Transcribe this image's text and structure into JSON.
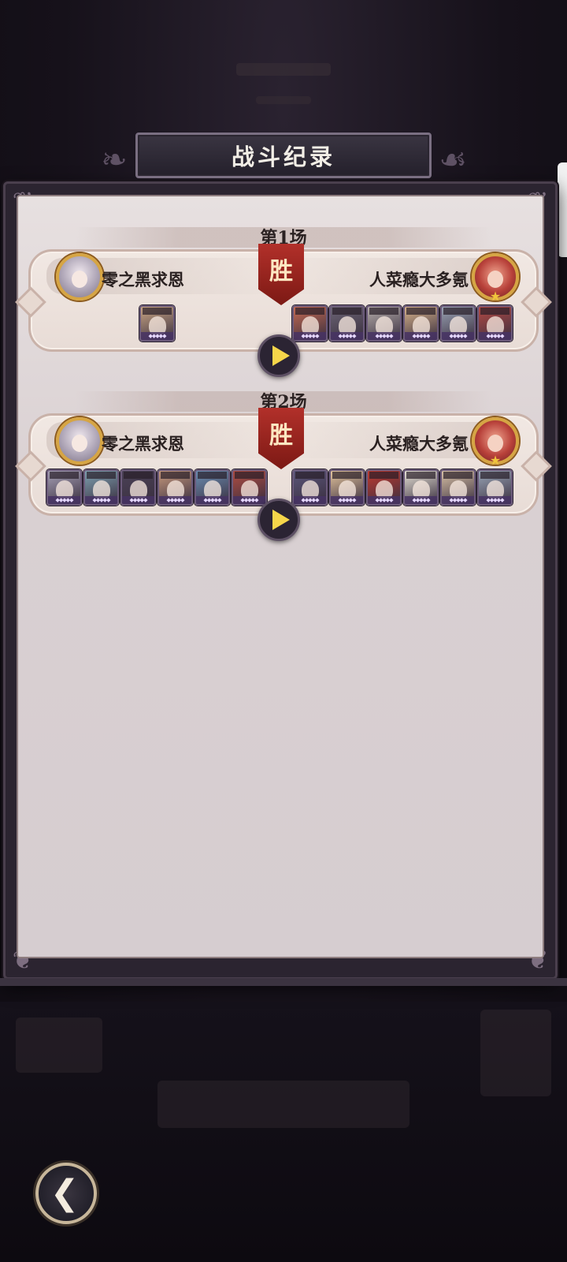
{
  "title": "战斗纪录",
  "matches": [
    {
      "label": "第1场",
      "result": "胜",
      "left_player": "零之黑求恩",
      "right_player": "人菜瘾大多氪",
      "left_heroes": [
        {
          "color": "#caa684"
        }
      ],
      "right_heroes": [
        {
          "color": "#c46a52"
        },
        {
          "color": "#6c6575"
        },
        {
          "color": "#b5adaa"
        },
        {
          "color": "#d7b28a"
        },
        {
          "color": "#9aa3b4"
        },
        {
          "color": "#b44a44"
        }
      ]
    },
    {
      "label": "第2场",
      "result": "胜",
      "left_player": "零之黑求恩",
      "right_player": "人菜瘾大多氪",
      "left_heroes": [
        {
          "color": "#a7a2b7"
        },
        {
          "color": "#7fa2b2"
        },
        {
          "color": "#4b4257"
        },
        {
          "color": "#c89a7e"
        },
        {
          "color": "#6c8fb4"
        },
        {
          "color": "#b04d42"
        }
      ],
      "right_heroes": [
        {
          "color": "#5b567a"
        },
        {
          "color": "#e4c59d"
        },
        {
          "color": "#c03a30"
        },
        {
          "color": "#e6e2d6"
        },
        {
          "color": "#d9c2a6"
        },
        {
          "color": "#9aa7b8"
        }
      ]
    }
  ],
  "icons": {
    "play": "play-icon",
    "back": "back-arrow-icon"
  },
  "colors": {
    "win_banner": "#a0241d",
    "play_triangle": "#f6d64a",
    "frame_gold": "#d6a544"
  }
}
